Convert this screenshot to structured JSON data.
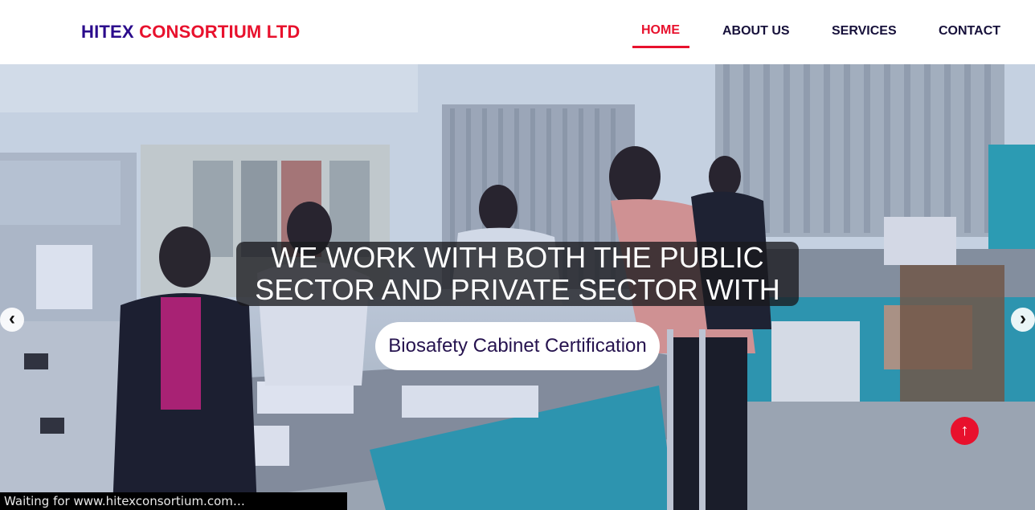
{
  "brand": {
    "part1": "HITEX",
    "part2": "CONSORTIUM LTD"
  },
  "nav": {
    "home": "HOME",
    "about": "ABOUT US",
    "services": "SERVICES",
    "contact": "CONTACT",
    "active": "HOME"
  },
  "hero": {
    "headline_line1": "WE WORK WITH BOTH THE PUBLIC",
    "headline_line2": "SECTOR AND PRIVATE SECTOR WITH",
    "service_pill": "Biosafety Cabinet Certification",
    "prev_icon": "chevron-left-icon",
    "next_icon": "chevron-right-icon",
    "prev_glyph": "‹",
    "next_glyph": "›"
  },
  "scroll_top": {
    "icon": "arrow-up-icon",
    "glyph": "↑"
  },
  "status_bar": {
    "text": "Waiting for www.hitexconsortium.com…"
  },
  "colors": {
    "brand_primary": "#2b0b8c",
    "accent_red": "#e8112d",
    "nav_text": "#16103a",
    "pill_text": "#26134f"
  }
}
